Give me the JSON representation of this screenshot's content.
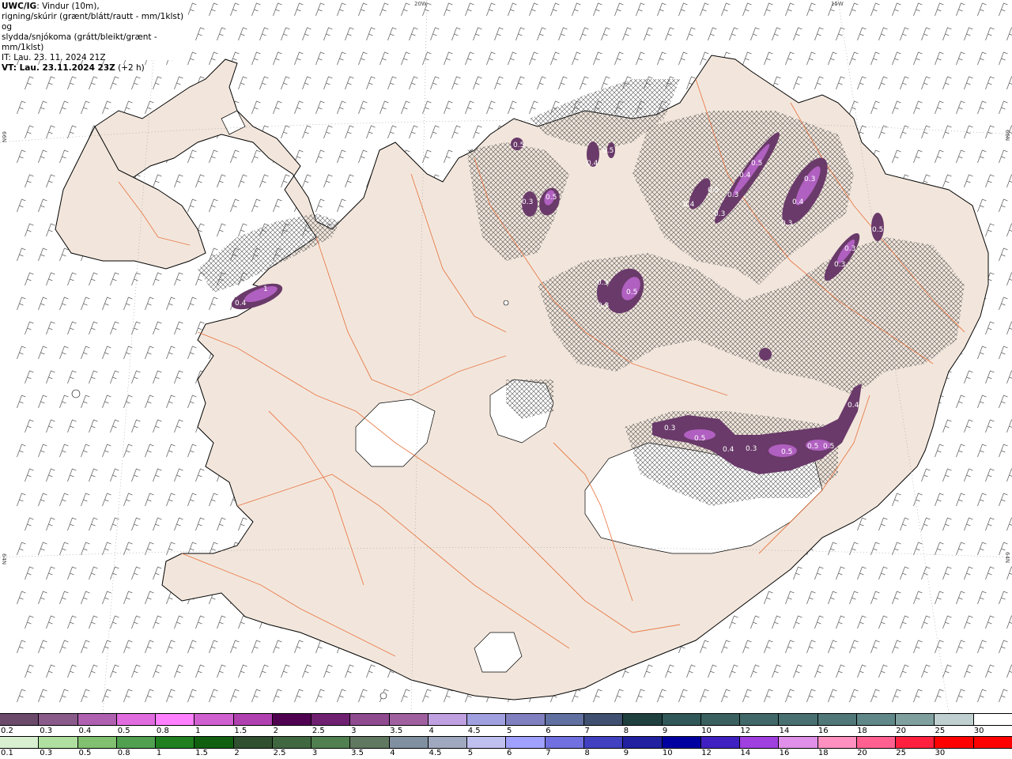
{
  "header": {
    "line1_bold": "UWC/IG",
    "line1_rest": ": Vindur (10m),",
    "line2": "rigning/skúrir (grænt/blátt/rautt - mm/1klst) og",
    "line3": "slydda/snjókoma (grátt/bleikt/grænt - mm/1klst)",
    "line4": "IT: Lau. 23. 11. 2024 21Z",
    "line5_bold": "VT: Lau. 23.11.2024 23Z",
    "line5_rest": " (+2 h)"
  },
  "grid_labels": {
    "lon_20w": "20W",
    "lon_15w": "15W",
    "lat_66n_left": "66N",
    "lat_66n_right": "66N",
    "lat_64n_left": "64N",
    "lat_64n_right": "64N"
  },
  "precip_labels": [
    "0.5",
    "0.5",
    "0.4",
    "0.3",
    "0.5",
    "0.4",
    "0.5",
    "0.3",
    "0.3",
    "0.4",
    "0.5",
    "0.4",
    "0.3",
    "0.3",
    "0.5",
    "0.3",
    "0.3",
    "0.5",
    "0.3",
    "0.3",
    "1",
    "0.4",
    "0.4",
    "0.3",
    "0.5",
    "0.4",
    "0.3",
    "0.5",
    "0.5",
    "0.5"
  ],
  "colors": {
    "land": "#f2e6dc",
    "roads": "#e8703a",
    "coast": "#000000",
    "hatch": "#555555",
    "precip_light": "#c070d0",
    "precip_dark": "#6a3a6a"
  },
  "snow_scale": {
    "labels": [
      "0.2",
      "0.3",
      "0.4",
      "0.5",
      "0.8",
      "1",
      "1.5",
      "2",
      "2.5",
      "3",
      "3.5",
      "4",
      "4.5",
      "5",
      "6",
      "7",
      "8",
      "9",
      "10",
      "12",
      "14",
      "16",
      "18",
      "20",
      "25",
      "30"
    ],
    "colors": [
      "#6b4a6b",
      "#8a5a8a",
      "#b060b0",
      "#e06ce0",
      "#ff80ff",
      "#d060d0",
      "#b040b0",
      "#500050",
      "#702070",
      "#904a90",
      "#a060a0",
      "#c0a0e0",
      "#a0a0e0",
      "#8080c0",
      "#6070a0",
      "#405070",
      "#204040",
      "#305858",
      "#3a6060",
      "#406868",
      "#487070",
      "#507878",
      "#608888",
      "#80a0a0",
      "#c0d0d0",
      "#ffffff"
    ]
  },
  "rain_scale": {
    "labels": [
      "0.1",
      "0.3",
      "0.5",
      "0.8",
      "1",
      "1.5",
      "2",
      "2.5",
      "3",
      "3.5",
      "4",
      "4.5",
      "5",
      "6",
      "7",
      "8",
      "9",
      "10",
      "12",
      "14",
      "16",
      "18",
      "20",
      "25",
      "30"
    ],
    "colors": [
      "#d8f0d0",
      "#b0e0a0",
      "#80c070",
      "#50a050",
      "#208020",
      "#106010",
      "#305030",
      "#406840",
      "#508050",
      "#607860",
      "#8090a0",
      "#a0a8c0",
      "#c0c0f0",
      "#a0a0ff",
      "#7070e0",
      "#4040c0",
      "#2020a0",
      "#0000a0",
      "#4020c0",
      "#a040e0",
      "#e090e8",
      "#ff90c0",
      "#ff6090",
      "#ff2040",
      "#ff0000",
      "#ff0000"
    ]
  }
}
